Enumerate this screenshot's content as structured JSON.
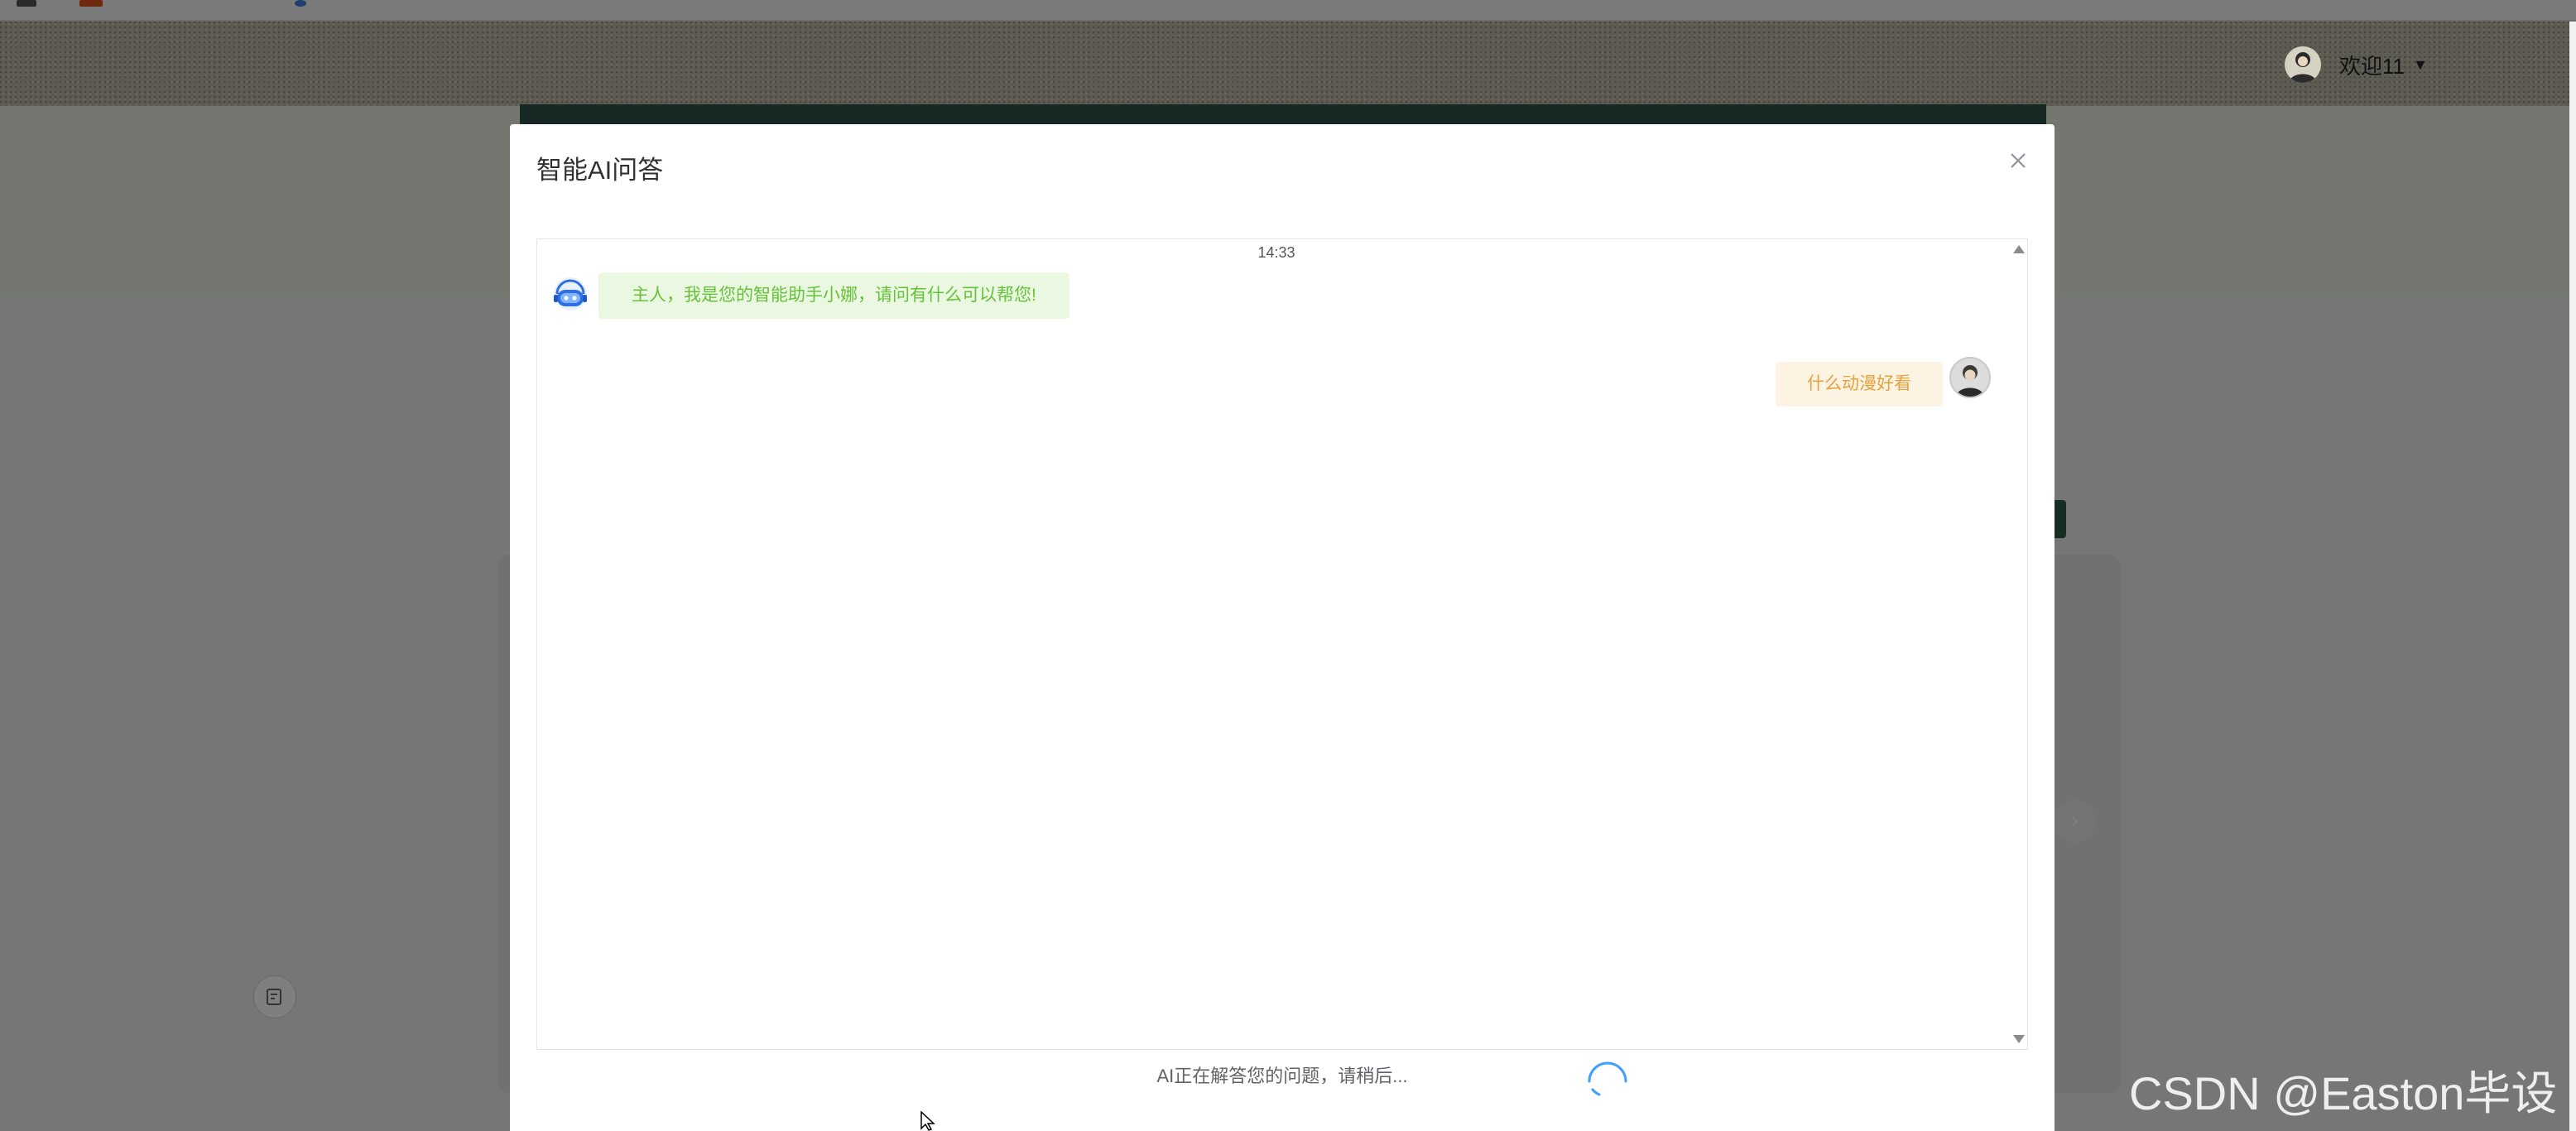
{
  "header": {
    "welcome_text": "欢迎11",
    "caret": "▼"
  },
  "background": {
    "next_arrow": "›"
  },
  "modal": {
    "title": "智能AI问答",
    "close_icon": "close-icon"
  },
  "chat": {
    "timestamp": "14:33",
    "messages": [
      {
        "role": "assistant",
        "text": "主人，我是您的智能助手小娜，请问有什么可以帮您!"
      },
      {
        "role": "user",
        "text": "什么动漫好看"
      }
    ]
  },
  "status": {
    "loading_text": "AI正在解答您的问题，请稍后..."
  },
  "watermark": "CSDN @Easton毕设",
  "colors": {
    "assistant_bubble_bg": "#eaf7e1",
    "assistant_text": "#67c23a",
    "user_bubble_bg": "#fdf3e3",
    "user_text": "#e6a23c",
    "spinner": "#409eff"
  }
}
